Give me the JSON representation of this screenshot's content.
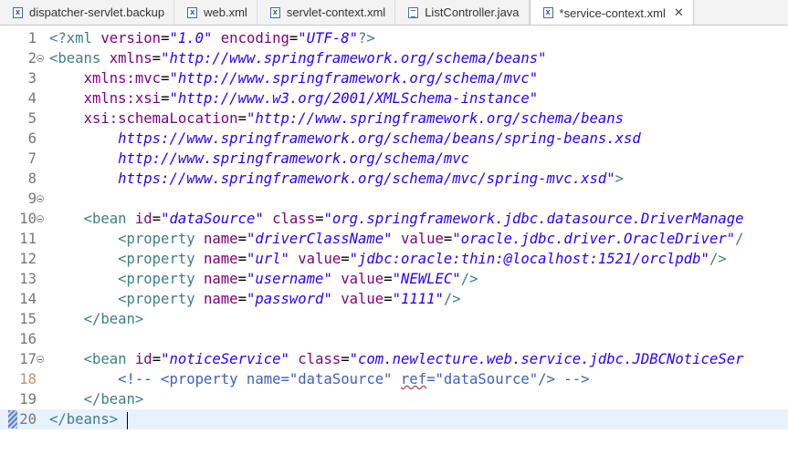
{
  "tabs": [
    {
      "label": "dispatcher-servlet.backup",
      "icon": "xml-file-icon",
      "active": false
    },
    {
      "label": "web.xml",
      "icon": "xml-file-icon",
      "active": false
    },
    {
      "label": "servlet-context.xml",
      "icon": "xml-file-icon",
      "active": false
    },
    {
      "label": "ListController.java",
      "icon": "java-file-icon",
      "active": false
    },
    {
      "label": "*service-context.xml",
      "icon": "xml-file-icon",
      "active": true,
      "close": "✕"
    }
  ],
  "editor": {
    "current_line": 20,
    "lines": [
      {
        "n": "1",
        "fold": false,
        "indent": "",
        "tokens": [
          [
            "pi",
            "<?xml "
          ],
          [
            "attr",
            "version"
          ],
          [
            "plain",
            "="
          ],
          [
            "val",
            "\"1.0\""
          ],
          [
            "plain",
            " "
          ],
          [
            "attr",
            "encoding"
          ],
          [
            "plain",
            "="
          ],
          [
            "val",
            "\"UTF-8\""
          ],
          [
            "pi",
            "?>"
          ]
        ]
      },
      {
        "n": "2",
        "fold": true,
        "indent": "",
        "tokens": [
          [
            "tag",
            "<beans "
          ],
          [
            "attr",
            "xmlns"
          ],
          [
            "plain",
            "="
          ],
          [
            "val",
            "\"http://www.springframework.org/schema/beans\""
          ]
        ]
      },
      {
        "n": "3",
        "fold": false,
        "indent": "    ",
        "tokens": [
          [
            "attr",
            "xmlns:mvc"
          ],
          [
            "plain",
            "="
          ],
          [
            "val",
            "\"http://www.springframework.org/schema/mvc\""
          ]
        ]
      },
      {
        "n": "4",
        "fold": false,
        "indent": "    ",
        "tokens": [
          [
            "attr",
            "xmlns:xsi"
          ],
          [
            "plain",
            "="
          ],
          [
            "val",
            "\"http://www.w3.org/2001/XMLSchema-instance\""
          ]
        ]
      },
      {
        "n": "5",
        "fold": false,
        "indent": "    ",
        "tokens": [
          [
            "attr",
            "xsi:schemaLocation"
          ],
          [
            "plain",
            "="
          ],
          [
            "val",
            "\"http://www.springframework.org/schema/beans"
          ]
        ]
      },
      {
        "n": "6",
        "fold": false,
        "indent": "        ",
        "tokens": [
          [
            "val",
            "https://www.springframework.org/schema/beans/spring-beans.xsd"
          ]
        ]
      },
      {
        "n": "7",
        "fold": false,
        "indent": "        ",
        "tokens": [
          [
            "val",
            "http://www.springframework.org/schema/mvc"
          ]
        ]
      },
      {
        "n": "8",
        "fold": false,
        "indent": "        ",
        "tokens": [
          [
            "val",
            "https://www.springframework.org/schema/mvc/spring-mvc.xsd\""
          ],
          [
            "tag",
            ">"
          ]
        ]
      },
      {
        "n": "9",
        "fold": true,
        "indent": "",
        "tokens": []
      },
      {
        "n": "10",
        "fold": true,
        "indent": "    ",
        "tokens": [
          [
            "tag",
            "<bean "
          ],
          [
            "attr",
            "id"
          ],
          [
            "plain",
            "="
          ],
          [
            "val",
            "\"dataSource\""
          ],
          [
            "plain",
            " "
          ],
          [
            "attr",
            "class"
          ],
          [
            "plain",
            "="
          ],
          [
            "val",
            "\"org.springframework.jdbc.datasource.DriverManage"
          ]
        ]
      },
      {
        "n": "11",
        "fold": false,
        "indent": "        ",
        "tokens": [
          [
            "tag",
            "<property "
          ],
          [
            "attr",
            "name"
          ],
          [
            "plain",
            "="
          ],
          [
            "val",
            "\"driverClassName\""
          ],
          [
            "plain",
            " "
          ],
          [
            "attr",
            "value"
          ],
          [
            "plain",
            "="
          ],
          [
            "val",
            "\"oracle.jdbc.driver.OracleDriver\""
          ],
          [
            "tag",
            "/"
          ]
        ]
      },
      {
        "n": "12",
        "fold": false,
        "indent": "        ",
        "tokens": [
          [
            "tag",
            "<property "
          ],
          [
            "attr",
            "name"
          ],
          [
            "plain",
            "="
          ],
          [
            "val",
            "\"url\""
          ],
          [
            "plain",
            " "
          ],
          [
            "attr",
            "value"
          ],
          [
            "plain",
            "="
          ],
          [
            "val",
            "\"jdbc:oracle:thin:@localhost:1521/orclpdb\""
          ],
          [
            "tag",
            "/>"
          ]
        ]
      },
      {
        "n": "13",
        "fold": false,
        "indent": "        ",
        "tokens": [
          [
            "tag",
            "<property "
          ],
          [
            "attr",
            "name"
          ],
          [
            "plain",
            "="
          ],
          [
            "val",
            "\"username\""
          ],
          [
            "plain",
            " "
          ],
          [
            "attr",
            "value"
          ],
          [
            "plain",
            "="
          ],
          [
            "val",
            "\"NEWLEC\""
          ],
          [
            "tag",
            "/>"
          ]
        ]
      },
      {
        "n": "14",
        "fold": false,
        "indent": "        ",
        "tokens": [
          [
            "tag",
            "<property "
          ],
          [
            "attr",
            "name"
          ],
          [
            "plain",
            "="
          ],
          [
            "val",
            "\"password\""
          ],
          [
            "plain",
            " "
          ],
          [
            "attr",
            "value"
          ],
          [
            "plain",
            "="
          ],
          [
            "val",
            "\"1111\""
          ],
          [
            "tag",
            "/>"
          ]
        ]
      },
      {
        "n": "15",
        "fold": false,
        "indent": "    ",
        "tokens": [
          [
            "tag",
            "</bean>"
          ]
        ]
      },
      {
        "n": "16",
        "fold": false,
        "indent": "",
        "tokens": []
      },
      {
        "n": "17",
        "fold": true,
        "indent": "    ",
        "tokens": [
          [
            "tag",
            "<bean "
          ],
          [
            "attr",
            "id"
          ],
          [
            "plain",
            "="
          ],
          [
            "val",
            "\"noticeService\""
          ],
          [
            "plain",
            " "
          ],
          [
            "attr",
            "class"
          ],
          [
            "plain",
            "="
          ],
          [
            "val",
            "\"com.newlecture.web.service.jdbc.JDBCNoticeSer"
          ]
        ]
      },
      {
        "n": "18",
        "fold": false,
        "indent": "        ",
        "tokens": [
          [
            "cmt",
            "<!-- <property name=\"dataSource\" "
          ],
          [
            "cmtwarn",
            "ref"
          ],
          [
            "cmt",
            "=\"dataSource\"/> -->"
          ]
        ]
      },
      {
        "n": "19",
        "fold": false,
        "indent": "    ",
        "tokens": [
          [
            "tag",
            "</bean>"
          ]
        ]
      },
      {
        "n": "20",
        "fold": false,
        "indent": "",
        "tokens": [
          [
            "tag",
            "</beans>"
          ],
          [
            "plain",
            " "
          ]
        ]
      }
    ]
  }
}
